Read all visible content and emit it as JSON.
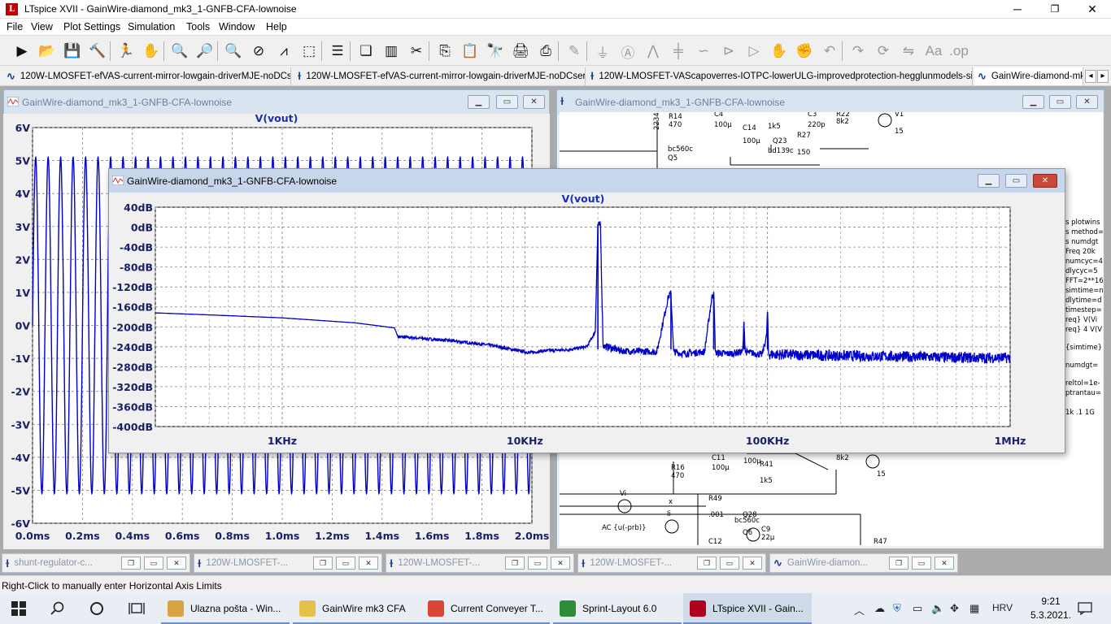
{
  "app": {
    "title": "LTspice XVII - GainWire-diamond_mk3_1-GNFB-CFA-lownoise",
    "minimize": "─",
    "restore": "❐",
    "close": "✕"
  },
  "menu": [
    "File",
    "View",
    "Plot Settings",
    "Simulation",
    "Tools",
    "Window",
    "Help"
  ],
  "toolbar_icons": [
    "run-icon",
    "open-icon",
    "save-icon",
    "control-panel-icon",
    "run-stop-icon",
    "pan-icon",
    "zoom-in-icon",
    "zoom-full-icon",
    "zoom-out-icon",
    "zoom-cancel-icon",
    "autorange-icon",
    "manual-limits-icon",
    "tile-horizontal-icon",
    "cascade-icon",
    "tile-vertical-icon",
    "cut-icon",
    "copy-icon",
    "paste-icon",
    "find-icon",
    "print-icon",
    "print-setup-icon",
    "draw-wire-icon",
    "ground-icon",
    "label-net-icon",
    "resistor-icon",
    "capacitor-icon",
    "inductor-icon",
    "diode-icon",
    "component-icon",
    "move-icon",
    "drag-icon",
    "undo-icon",
    "redo-icon",
    "rotate-icon",
    "mirror-icon",
    "text-icon",
    "spice-directive-icon"
  ],
  "tabs": [
    {
      "icon": "waveform-icon",
      "label": "120W-LMOSFET-efVAS-current-mirror-lowgain-driverMJE-noDCservo"
    },
    {
      "icon": "schematic-icon",
      "label": "120W-LMOSFET-efVAS-current-mirror-lowgain-driverMJE-noDCservo"
    },
    {
      "icon": "schematic-icon",
      "label": "120W-LMOSFET-VAScapoverres-IOTPC-lowerULG-improvedprotection-hegglunmodels-simple"
    },
    {
      "icon": "waveform-icon",
      "label": "GainWire-diamond-mk"
    }
  ],
  "tab_scroll": {
    "left": "◂",
    "right": "▸"
  },
  "windows": {
    "time_plot": {
      "title": "GainWire-diamond_mk3_1-GNFB-CFA-lownoise",
      "trace": "V(vout)",
      "y_ticks": [
        "6V",
        "5V",
        "4V",
        "3V",
        "2V",
        "1V",
        "0V",
        "-1V",
        "-2V",
        "-3V",
        "-4V",
        "-5V",
        "-6V"
      ],
      "x_ticks": [
        "0.0ms",
        "0.2ms",
        "0.4ms",
        "0.6ms",
        "0.8ms",
        "1.0ms",
        "1.2ms",
        "1.4ms",
        "1.6ms",
        "1.8ms",
        "2.0ms"
      ]
    },
    "schematic": {
      "title": "GainWire-diamond_mk3_1-GNFB-CFA-lownoise",
      "labels_top": [
        "R14",
        "470",
        "C4",
        "100µ",
        "C14",
        "100µ",
        "1k5",
        "C3",
        "220p",
        "R22",
        "8k2",
        "V1",
        "15",
        "Q23",
        "bd139c",
        "R27",
        "150",
        "bc560c",
        "Q5",
        "2234798"
      ],
      "directives": [
        "s plotwins",
        "s method=",
        "s numdgt",
        "Freq 20k",
        "numcyc=4",
        "dlycyc=5",
        "FFT=2**16",
        "simtime=n",
        "dlytime=d",
        "timestep=",
        "req} V(Vi",
        "req} 4 V(V",
        "{simtime}",
        "numdgt=",
        "reltol=1e-",
        "ptrantau=",
        "1k .1 1G"
      ],
      "labels_bottom": [
        "R16",
        "470",
        "C11",
        "100µ",
        "100µ",
        "R41",
        "1k5",
        "8k2",
        "15",
        "Vi",
        "R49",
        ".001",
        "x",
        "Ii",
        "AC {u(-prb)}",
        "bc560c",
        "Q6",
        "Q28",
        "C9",
        "22µ",
        "R47",
        "C12"
      ]
    },
    "fft_plot": {
      "title": "GainWire-diamond_mk3_1-GNFB-CFA-lownoise",
      "trace": "V(vout)",
      "y_ticks": [
        "40dB",
        "0dB",
        "-40dB",
        "-80dB",
        "-120dB",
        "-160dB",
        "-200dB",
        "-240dB",
        "-280dB",
        "-320dB",
        "-360dB",
        "-400dB"
      ],
      "x_ticks": [
        "1KHz",
        "10KHz",
        "100KHz",
        "1MHz"
      ]
    }
  },
  "chart_data": [
    {
      "type": "line",
      "title": "V(vout)",
      "xlabel": "",
      "ylabel": "",
      "x_unit": "ms",
      "y_unit": "V",
      "xlim": [
        0,
        2.0
      ],
      "ylim": [
        -6,
        6
      ],
      "grid": true,
      "series": [
        {
          "name": "V(vout)",
          "description_values": {
            "frequency_khz": 20,
            "amplitude_v": 5.1,
            "offset_v": 0
          }
        }
      ]
    },
    {
      "type": "line",
      "title": "V(vout)",
      "xlabel": "",
      "ylabel": "",
      "x_scale": "log",
      "x_unit": "Hz",
      "y_unit": "dB",
      "xlim": [
        300,
        1000000
      ],
      "ylim": [
        -400,
        40
      ],
      "grid": true,
      "series": [
        {
          "name": "V(vout)",
          "x": [
            300,
            500,
            1000,
            2000,
            2900,
            3000,
            3500,
            5000,
            7000,
            9000,
            10500,
            12000,
            15000,
            18000,
            19500,
            20000,
            20500,
            21000,
            25000,
            35000,
            39000,
            40000,
            41000,
            45000,
            55000,
            59000,
            60000,
            61000,
            70000,
            79000,
            80000,
            81000,
            95000,
            99000,
            100000,
            101000,
            200000,
            400000,
            700000,
            1000000
          ],
          "y": [
            -172,
            -176,
            -182,
            -192,
            -202,
            -220,
            -222,
            -228,
            -236,
            -246,
            -252,
            -248,
            -246,
            -240,
            -210,
            6,
            2,
            -238,
            -248,
            -250,
            -140,
            -132,
            -250,
            -254,
            -250,
            -140,
            -130,
            -252,
            -254,
            -250,
            -190,
            -250,
            -256,
            -220,
            -170,
            -255,
            -258,
            -260,
            -262,
            -262
          ]
        }
      ],
      "peaks": [
        {
          "x": 20000,
          "y": 6
        },
        {
          "x": 40000,
          "y": -132
        },
        {
          "x": 60000,
          "y": -130
        },
        {
          "x": 80000,
          "y": -190
        },
        {
          "x": 100000,
          "y": -170
        }
      ]
    }
  ],
  "mdi_minimized": [
    {
      "label": "shunt-regulator-c..."
    },
    {
      "label": "120W-LMOSFET-..."
    },
    {
      "label": "120W-LMOSFET-..."
    },
    {
      "label": "120W-LMOSFET-..."
    },
    {
      "label": "GainWire-diamon..."
    }
  ],
  "status": "Right-Click to manually enter Horizontal Axis Limits",
  "taskbar": {
    "items": [
      {
        "label": "Ulazna pošta - Win...",
        "color": "#d9a441"
      },
      {
        "label": "GainWire mk3 CFA",
        "color": "#e6c14a"
      },
      {
        "label": "Current Conveyer T...",
        "color": "#db4437"
      },
      {
        "label": "Sprint-Layout 6.0",
        "color": "#2e8b3a"
      },
      {
        "label": "LTspice XVII - Gain...",
        "color": "#b00020"
      }
    ],
    "lang": "HRV",
    "time": "9:21",
    "date": "5.3.2021."
  }
}
